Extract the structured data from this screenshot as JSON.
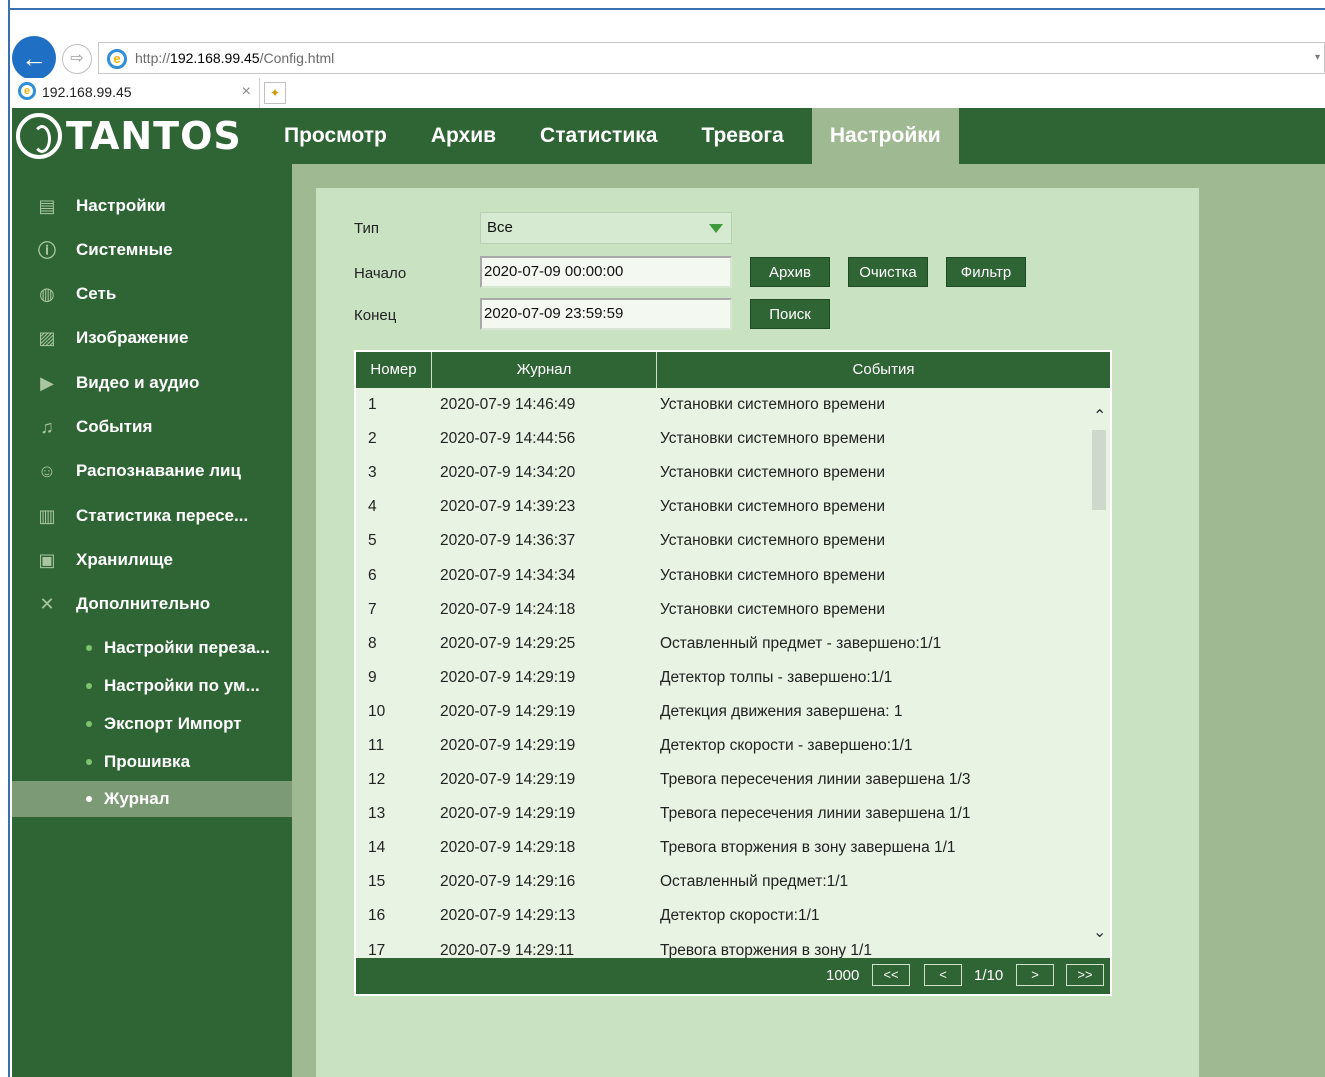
{
  "browser": {
    "url_prefix": "http://",
    "url_host": "192.168.99.45",
    "url_path": "/Config.html",
    "tab_title": "192.168.99.45",
    "tab_close": "×"
  },
  "brand": {
    "logo_text": "TANTOS"
  },
  "topnav": [
    {
      "label": "Просмотр"
    },
    {
      "label": "Архив"
    },
    {
      "label": "Статистика"
    },
    {
      "label": "Тревога"
    },
    {
      "label": "Настройки",
      "active": true
    }
  ],
  "sidebar": {
    "items": [
      {
        "label": "Настройки",
        "icon": "settings-icon"
      },
      {
        "label": "Системные",
        "icon": "info-icon"
      },
      {
        "label": "Сеть",
        "icon": "globe-icon"
      },
      {
        "label": "Изображение",
        "icon": "image-icon"
      },
      {
        "label": "Видео и аудио",
        "icon": "video-icon"
      },
      {
        "label": "События",
        "icon": "bell-icon"
      },
      {
        "label": "Распознавание лиц",
        "icon": "face-icon"
      },
      {
        "label": "Статистика пересе...",
        "icon": "bar-chart-icon"
      },
      {
        "label": "Хранилище",
        "icon": "disk-icon"
      },
      {
        "label": "Дополнительно",
        "icon": "tools-icon"
      }
    ],
    "subitems": [
      {
        "label": "Настройки переза..."
      },
      {
        "label": "Настройки по ум..."
      },
      {
        "label": "Экспорт Импорт"
      },
      {
        "label": "Прошивка"
      },
      {
        "label": "Журнал",
        "active": true
      }
    ]
  },
  "filter": {
    "type_label": "Тип",
    "type_value": "Все",
    "start_label": "Начало",
    "start_value": "2020-07-09 00:00:00",
    "end_label": "Конец",
    "end_value": "2020-07-09 23:59:59",
    "archive_button": "Архив",
    "clear_button": "Очистка",
    "filter_button": "Фильтр",
    "search_button": "Поиск"
  },
  "table": {
    "columns": [
      "Номер",
      "Журнал",
      "События"
    ],
    "rows": [
      [
        "1",
        "2020-07-9 14:46:49",
        "Установки системного времени"
      ],
      [
        "2",
        "2020-07-9 14:44:56",
        "Установки системного времени"
      ],
      [
        "3",
        "2020-07-9 14:34:20",
        "Установки системного времени"
      ],
      [
        "4",
        "2020-07-9 14:39:23",
        "Установки системного времени"
      ],
      [
        "5",
        "2020-07-9 14:36:37",
        "Установки системного времени"
      ],
      [
        "6",
        "2020-07-9 14:34:34",
        "Установки системного времени"
      ],
      [
        "7",
        "2020-07-9 14:24:18",
        "Установки системного времени"
      ],
      [
        "8",
        "2020-07-9 14:29:25",
        "Оставленный предмет - завершено:1/1"
      ],
      [
        "9",
        "2020-07-9 14:29:19",
        "Детектор толпы - завершено:1/1"
      ],
      [
        "10",
        "2020-07-9 14:29:19",
        "Детекция движения завершена: 1"
      ],
      [
        "11",
        "2020-07-9 14:29:19",
        "Детектор скорости - завершено:1/1"
      ],
      [
        "12",
        "2020-07-9 14:29:19",
        "Тревога пересечения линии завершена 1/3"
      ],
      [
        "13",
        "2020-07-9 14:29:19",
        "Тревога пересечения линии завершена 1/1"
      ],
      [
        "14",
        "2020-07-9 14:29:18",
        "Тревога вторжения в зону завершена 1/1"
      ],
      [
        "15",
        "2020-07-9 14:29:16",
        "Оставленный предмет:1/1"
      ],
      [
        "16",
        "2020-07-9 14:29:13",
        "Детектор скорости:1/1"
      ],
      [
        "17",
        "2020-07-9 14:29:11",
        "Тревога вторжения в зону 1/1"
      ]
    ]
  },
  "pagination": {
    "total": "1000",
    "first": "<<",
    "prev": "<",
    "page_info": "1/10",
    "next": ">",
    "last": ">>"
  },
  "colors": {
    "header_green": "#2f6534",
    "active_tab": "#9fba92",
    "panel_bg": "#c8e2c2",
    "table_bg": "#e8f3e4"
  }
}
